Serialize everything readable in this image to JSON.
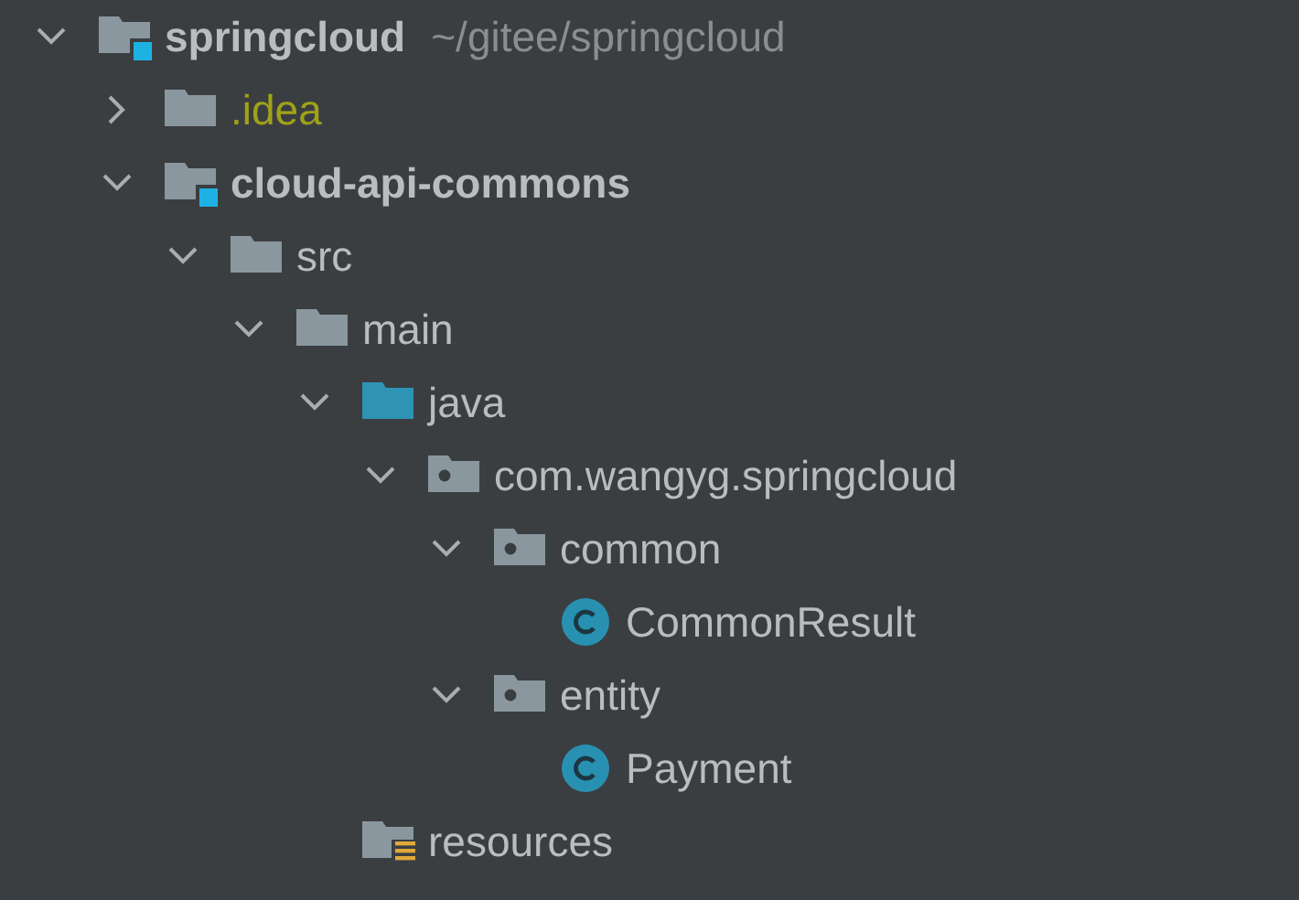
{
  "project_tree": [
    {
      "label": "springcloud",
      "kind": "module",
      "path": "~/gitee/springcloud",
      "expanded": true,
      "ignored": false,
      "children": [
        {
          "label": ".idea",
          "kind": "folder",
          "expanded": false,
          "ignored": true
        },
        {
          "label": "cloud-api-commons",
          "kind": "module",
          "expanded": true,
          "ignored": false,
          "children": [
            {
              "label": "src",
              "kind": "folder",
              "expanded": true,
              "ignored": false,
              "children": [
                {
                  "label": "main",
                  "kind": "folder",
                  "expanded": true,
                  "ignored": false,
                  "children": [
                    {
                      "label": "java",
                      "kind": "source-folder",
                      "expanded": true,
                      "ignored": false,
                      "children": [
                        {
                          "label": "com.wangyg.springcloud",
                          "kind": "package",
                          "expanded": true,
                          "ignored": false,
                          "children": [
                            {
                              "label": "common",
                              "kind": "package",
                              "expanded": true,
                              "ignored": false,
                              "children": [
                                {
                                  "label": "CommonResult",
                                  "kind": "class",
                                  "ignored": false
                                }
                              ]
                            },
                            {
                              "label": "entity",
                              "kind": "package",
                              "expanded": true,
                              "ignored": false,
                              "children": [
                                {
                                  "label": "Payment",
                                  "kind": "class",
                                  "ignored": false
                                }
                              ]
                            }
                          ]
                        }
                      ]
                    },
                    {
                      "label": "resources",
                      "kind": "resources-folder",
                      "ignored": false
                    }
                  ]
                }
              ]
            }
          ]
        }
      ]
    }
  ]
}
